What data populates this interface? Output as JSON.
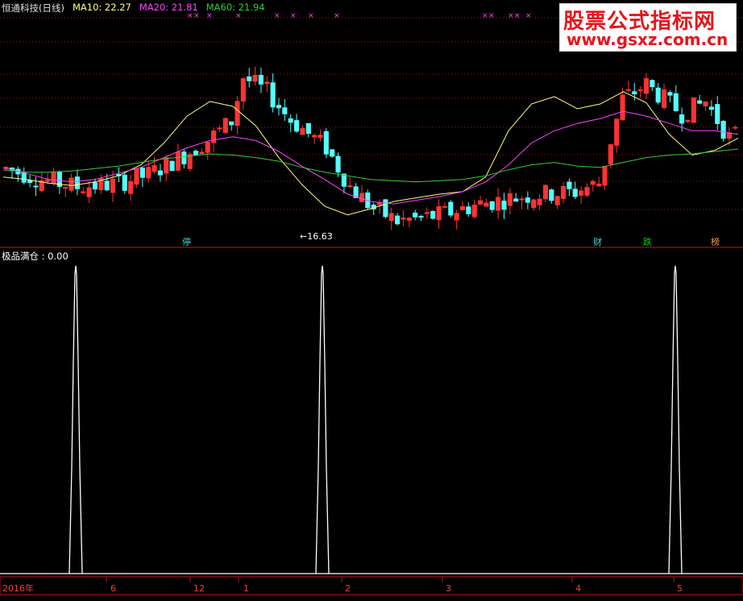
{
  "header": {
    "stock_name": "恒通科技(日线)",
    "ma10": "MA10: 22.27",
    "ma20": "MA20: 21.81",
    "ma60": "MA60: 21.94"
  },
  "watermark": {
    "line1": "股票公式指标网",
    "line2": "www.gsxz.com.cn"
  },
  "indicator_title": "极品满仓 : 0.00",
  "low_marker": "16.63",
  "badges": [
    {
      "text": "停",
      "color": "#37d8d8"
    },
    {
      "text": "财",
      "color": "#37d8d8"
    },
    {
      "text": "跌",
      "color": "#00d000"
    },
    {
      "text": "榜",
      "color": "#e2a04a"
    }
  ],
  "x_axis_labels": [
    "2016年",
    "6",
    "12",
    "1",
    "2",
    "3",
    "4",
    "5"
  ],
  "colors": {
    "up": "#ff3333",
    "down": "#54ffff",
    "ma10": "#ffff7f",
    "ma20": "#ff44ff",
    "ma60": "#33cc33",
    "grid": "#b0151a",
    "signal": "#ffffff"
  },
  "chart_data": [
    {
      "type": "candlestick",
      "title": "恒通科技(日线)",
      "series": [
        {
          "name": "MA10",
          "values": [
            20.8,
            20.6,
            20.3,
            20.1,
            20.4,
            20.9,
            21.8,
            23.6,
            25.8,
            27.0,
            26.6,
            25.0,
            22.4,
            20.2,
            18.4,
            17.7,
            18.2,
            18.8,
            19.1,
            19.4,
            19.6,
            20.8,
            24.6,
            26.8,
            27.4,
            26.4,
            26.8,
            27.8,
            26.9,
            24.3,
            22.6,
            23.0,
            24.0
          ]
        },
        {
          "name": "MA20",
          "values": [
            21.6,
            21.1,
            20.6,
            20.4,
            20.6,
            21.1,
            21.6,
            22.4,
            23.2,
            23.8,
            24.1,
            23.8,
            22.9,
            21.7,
            20.6,
            19.4,
            18.8,
            18.6,
            18.9,
            19.2,
            19.6,
            20.4,
            21.8,
            23.6,
            24.6,
            25.2,
            25.6,
            26.2,
            25.8,
            25.2,
            24.6,
            24.6,
            24.3
          ]
        },
        {
          "name": "MA60",
          "values": [
            21.4,
            21.2,
            21.2,
            21.3,
            21.5,
            21.7,
            22.0,
            22.3,
            22.5,
            22.7,
            22.6,
            22.4,
            22.1,
            21.6,
            21.2,
            20.9,
            20.6,
            20.5,
            20.4,
            20.5,
            20.6,
            20.9,
            21.4,
            21.8,
            22.0,
            21.7,
            21.6,
            22.0,
            22.4,
            22.6,
            22.7,
            22.9,
            23.1
          ]
        }
      ],
      "low_annotation": 16.63,
      "ma10_value": 22.27,
      "ma20_value": 21.81,
      "ma60_value": 21.94
    },
    {
      "type": "line",
      "title": "极品满仓",
      "current_value": 0.0,
      "signal_positions": [
        "2016-05",
        "2017-01",
        "2017-05"
      ]
    }
  ]
}
